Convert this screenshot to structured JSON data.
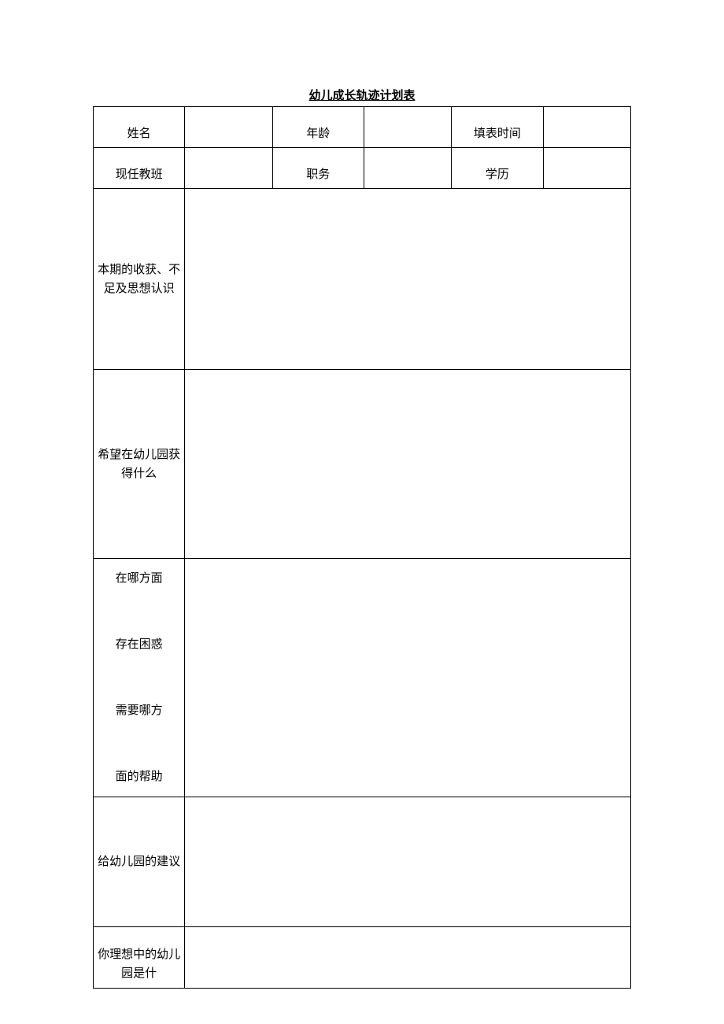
{
  "title": "幼儿成长轨迹计划表",
  "headers": {
    "row1": {
      "name": "姓名",
      "age": "年龄",
      "fillTime": "填表时间"
    },
    "row2": {
      "class": "现任教班",
      "position": "职务",
      "education": "学历"
    }
  },
  "sections": {
    "gains": "本期的收获、不足及思想认识",
    "hope": "希望在幼儿园获得什么",
    "help": "在哪方面\n\n存在困惑\n\n需要哪方\n\n面的帮助",
    "suggest": "给幼儿园的建议",
    "ideal": "你理想中的幼儿园是什"
  },
  "values": {
    "name": "",
    "age": "",
    "fillTime": "",
    "class": "",
    "position": "",
    "education": "",
    "gains": "",
    "hope": "",
    "help": "",
    "suggest": "",
    "ideal": ""
  }
}
